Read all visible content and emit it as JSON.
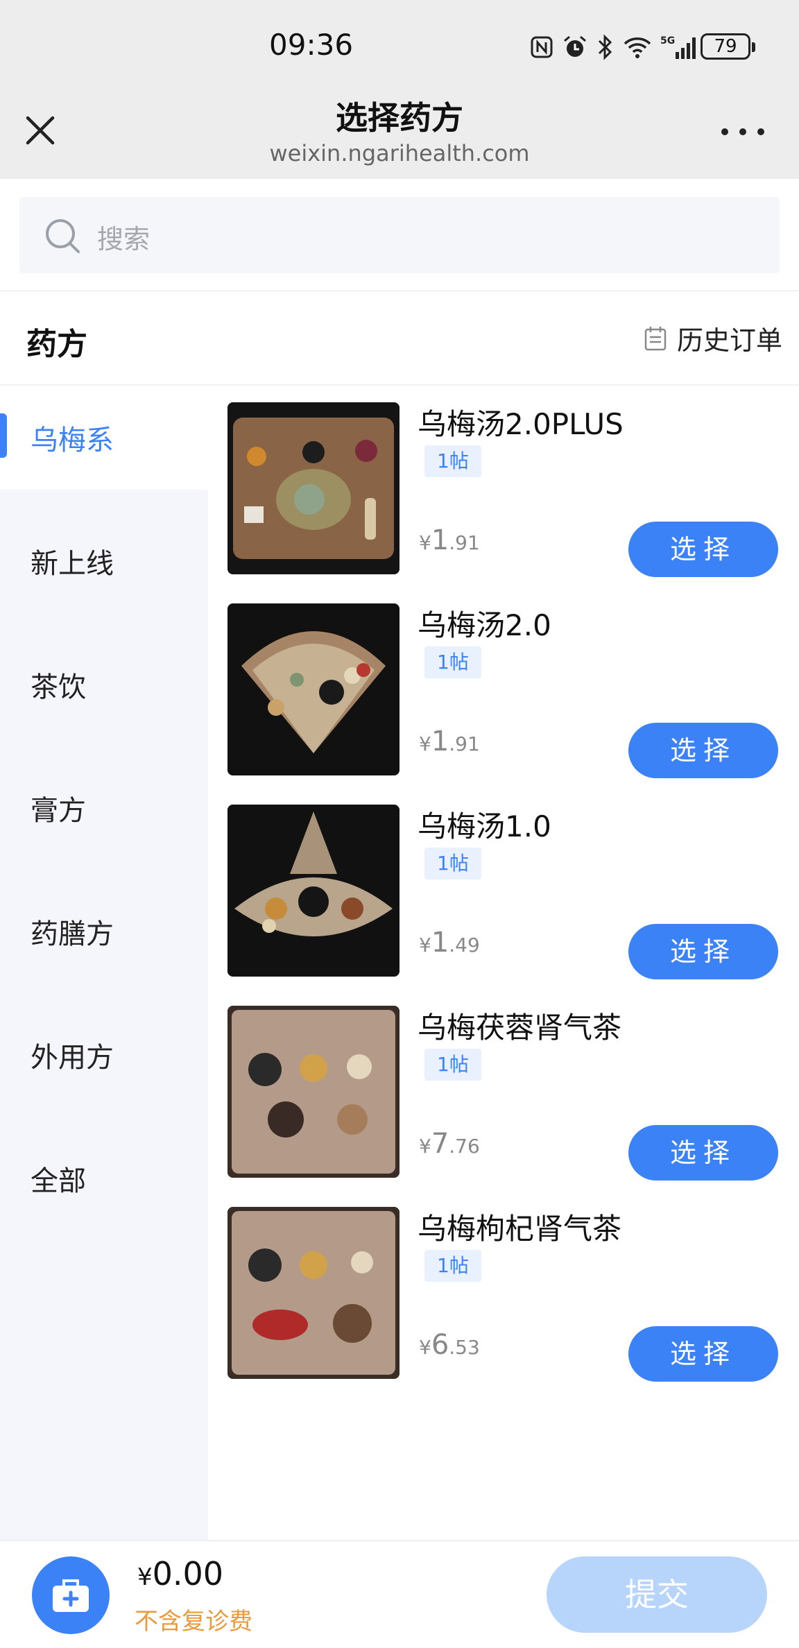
{
  "status_bar": {
    "time": "09:36",
    "battery": "79",
    "network": "5G"
  },
  "title_bar": {
    "title": "选择药方",
    "domain": "weixin.ngarihealth.com"
  },
  "search": {
    "placeholder": "搜索"
  },
  "section": {
    "title": "药方",
    "history_label": "历史订单"
  },
  "sidebar": {
    "items": [
      {
        "label": "乌梅系",
        "active": true
      },
      {
        "label": "新上线"
      },
      {
        "label": "茶饮"
      },
      {
        "label": "膏方"
      },
      {
        "label": "药膳方"
      },
      {
        "label": "外用方"
      },
      {
        "label": "全部"
      }
    ]
  },
  "products": [
    {
      "name": "乌梅汤2.0PLUS",
      "tag": "1帖",
      "currency": "¥",
      "price_int": "1",
      "price_dec": ".91",
      "button": "选择"
    },
    {
      "name": "乌梅汤2.0",
      "tag": "1帖",
      "currency": "¥",
      "price_int": "1",
      "price_dec": ".91",
      "button": "选择"
    },
    {
      "name": "乌梅汤1.0",
      "tag": "1帖",
      "currency": "¥",
      "price_int": "1",
      "price_dec": ".49",
      "button": "选择"
    },
    {
      "name": "乌梅茯蓉肾气茶",
      "tag": "1帖",
      "currency": "¥",
      "price_int": "7",
      "price_dec": ".76",
      "button": "选择"
    },
    {
      "name": "乌梅枸杞肾气茶",
      "tag": "1帖",
      "currency": "¥",
      "price_int": "6",
      "price_dec": ".53",
      "button": "选择"
    }
  ],
  "bottom": {
    "currency": "¥",
    "total": "0.00",
    "note": "不含复诊费",
    "submit_label": "提交"
  },
  "colors": {
    "accent": "#3b82f6",
    "tag_bg": "#e8f1fd",
    "submit_disabled": "#b7d4fb",
    "note": "#e89a3c"
  }
}
